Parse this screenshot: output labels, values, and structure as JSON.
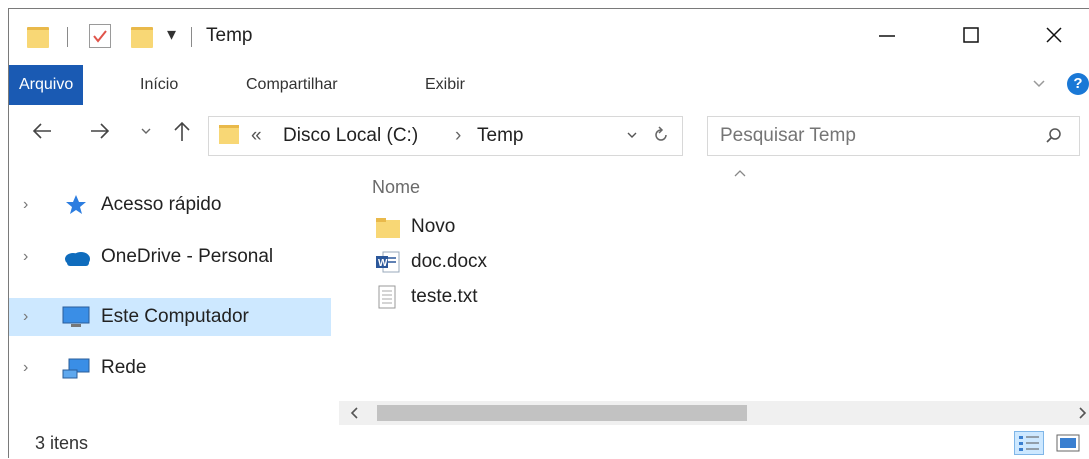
{
  "window": {
    "title": "Temp"
  },
  "window_controls": {
    "minimize": "—",
    "maximize": "☐",
    "close": "✕"
  },
  "ribbon": {
    "tabs": [
      {
        "label": "Arquivo"
      },
      {
        "label": "Início"
      },
      {
        "label": "Compartilhar"
      },
      {
        "label": "Exibir"
      }
    ],
    "expand_icon": "chevron-down-icon",
    "help_label": "?"
  },
  "address_bar": {
    "prefix": "«",
    "path": [
      {
        "label": "Disco Local (C:)"
      },
      {
        "label": "Temp"
      }
    ],
    "separator": "›"
  },
  "search": {
    "placeholder": "Pesquisar Temp"
  },
  "sidebar": {
    "items": [
      {
        "label": "Acesso rápido",
        "icon": "star-pin-icon",
        "selected": false
      },
      {
        "label": "OneDrive - Personal",
        "icon": "cloud-icon",
        "selected": false
      },
      {
        "label": "Este Computador",
        "icon": "computer-icon",
        "selected": true
      },
      {
        "label": "Rede",
        "icon": "network-icon",
        "selected": false
      }
    ]
  },
  "file_list": {
    "column_header": "Nome",
    "items": [
      {
        "name": "Novo",
        "icon": "folder-icon"
      },
      {
        "name": "doc.docx",
        "icon": "word-doc-icon"
      },
      {
        "name": "teste.txt",
        "icon": "text-file-icon"
      }
    ]
  },
  "status_bar": {
    "item_count": "3 itens"
  },
  "colors": {
    "accent": "#1a5ab3",
    "selection": "#cde8ff",
    "folder": "#f8d775"
  }
}
